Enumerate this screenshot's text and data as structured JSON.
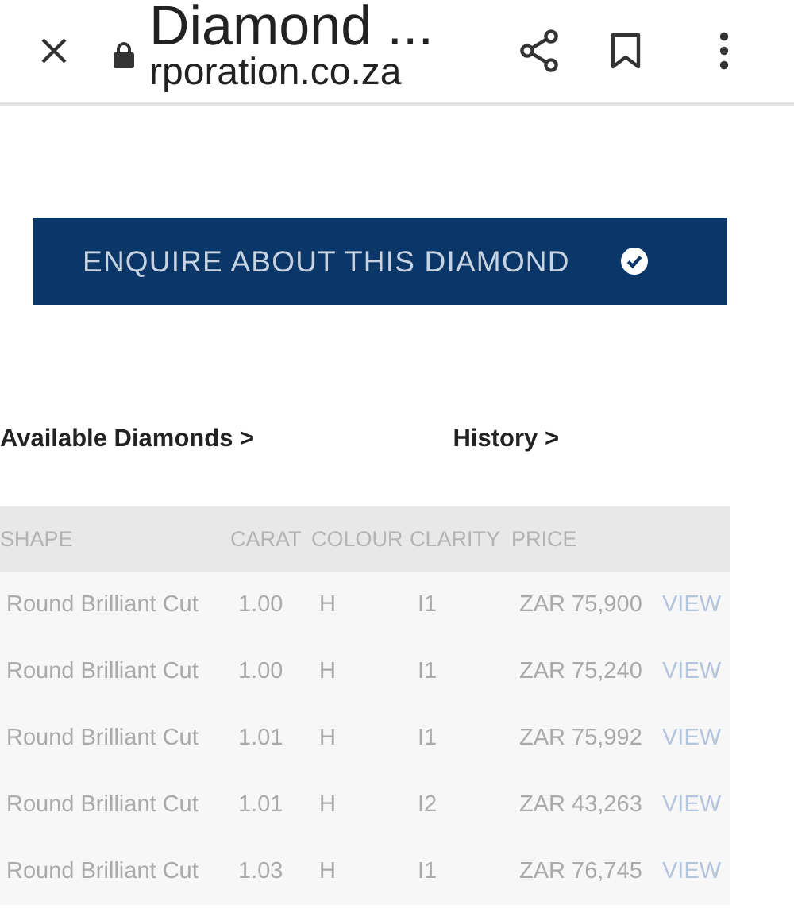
{
  "browser_bar": {
    "title": "Diamond ...",
    "url": "rporation.co.za"
  },
  "enquire_button": {
    "label": "ENQUIRE ABOUT THIS DIAMOND"
  },
  "links": [
    "Available Diamonds >",
    "History >"
  ],
  "table": {
    "columns": [
      "SHAPE",
      "CARAT",
      "COLOUR",
      "CLARITY",
      "PRICE"
    ],
    "rows": [
      {
        "shape": "Round Brilliant Cut",
        "carat": "1.00",
        "colour": "H",
        "clarity": "I1",
        "price": "ZAR 75,900",
        "action": "VIEW"
      },
      {
        "shape": "Round Brilliant Cut",
        "carat": "1.00",
        "colour": "H",
        "clarity": "I1",
        "price": "ZAR 75,240",
        "action": "VIEW"
      },
      {
        "shape": "Round Brilliant Cut",
        "carat": "1.01",
        "colour": "H",
        "clarity": "I1",
        "price": "ZAR 75,992",
        "action": "VIEW"
      },
      {
        "shape": "Round Brilliant Cut",
        "carat": "1.01",
        "colour": "H",
        "clarity": "I2",
        "price": "ZAR 43,263",
        "action": "VIEW"
      },
      {
        "shape": "Round Brilliant Cut",
        "carat": "1.03",
        "colour": "H",
        "clarity": "I1",
        "price": "ZAR 76,745",
        "action": "VIEW"
      }
    ]
  }
}
